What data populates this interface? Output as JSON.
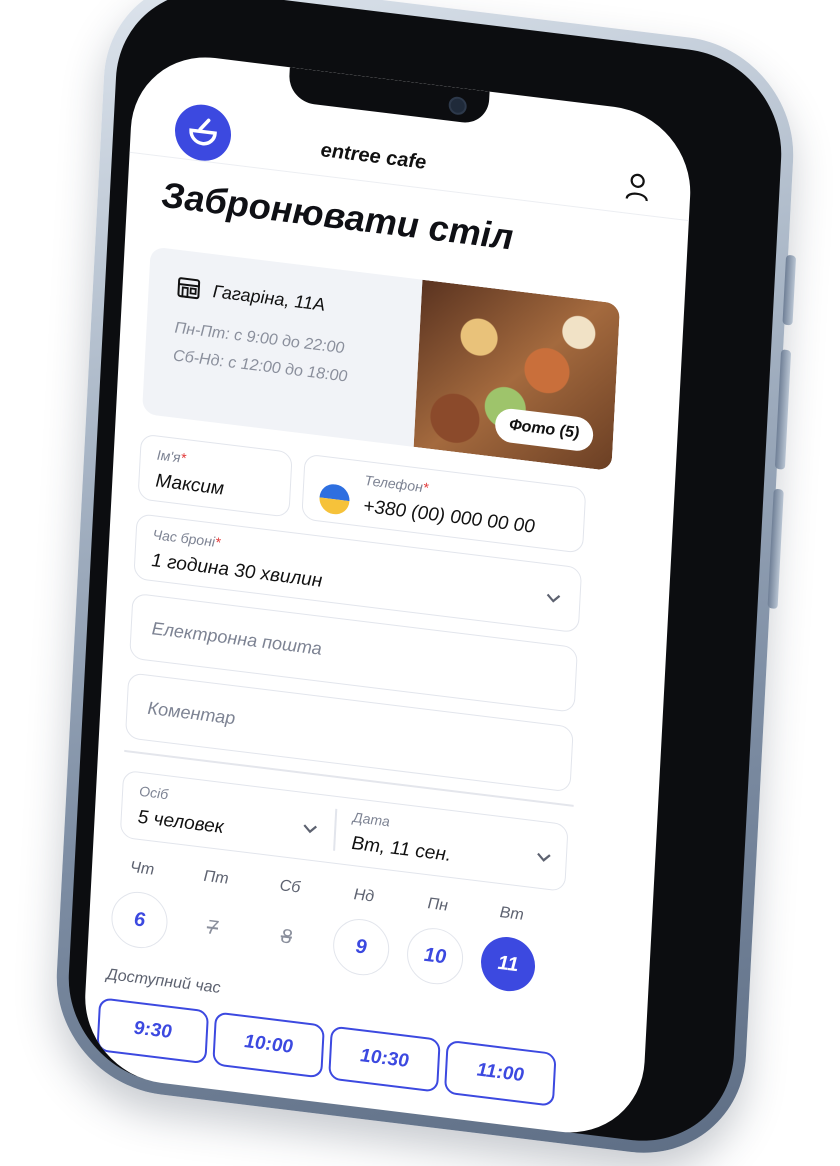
{
  "header": {
    "brand": "entree cafe",
    "logo_icon": "entree-logo-icon",
    "profile_icon": "user-icon"
  },
  "page_title": "Забронювати стіл",
  "location": {
    "address": "Гагаріна, 11A",
    "hours_weekdays": "Пн-Пт: с 9:00 до 22:00",
    "hours_weekend": "Сб-Нд: с 12:00 до 18:00",
    "photo_button": "Фото (5)",
    "icon": "store-icon"
  },
  "form": {
    "name": {
      "label": "Ім'я",
      "required_mark": "*",
      "value": "Максим"
    },
    "phone": {
      "label": "Телефон",
      "required_mark": "*",
      "value": "+380 (00) 000 00 00",
      "flag_icon": "ukraine-flag-icon"
    },
    "booking_time": {
      "label": "Час броні",
      "required_mark": "*",
      "value": "1 година 30 хвилин"
    },
    "email": {
      "placeholder": "Електронна пошта"
    },
    "comment": {
      "placeholder": "Коментар"
    },
    "guests": {
      "label": "Осіб",
      "value": "5 человек"
    },
    "date": {
      "label": "Дата",
      "value": "Вт, 11 сен."
    }
  },
  "days": [
    {
      "name": "Чт",
      "num": "6",
      "state": "available"
    },
    {
      "name": "Пт",
      "num": "7",
      "state": "disabled"
    },
    {
      "name": "Сб",
      "num": "8",
      "state": "disabled"
    },
    {
      "name": "Нд",
      "num": "9",
      "state": "available"
    },
    {
      "name": "Пн",
      "num": "10",
      "state": "available"
    },
    {
      "name": "Вт",
      "num": "11",
      "state": "selected"
    }
  ],
  "available_time": {
    "label": "Доступний час",
    "slots": [
      "9:30",
      "10:00",
      "10:30",
      "11:00"
    ]
  },
  "colors": {
    "accent": "#3c49e0",
    "required": "#e23b3b",
    "muted_text": "#7d8393",
    "card_bg": "#f1f3f7"
  }
}
